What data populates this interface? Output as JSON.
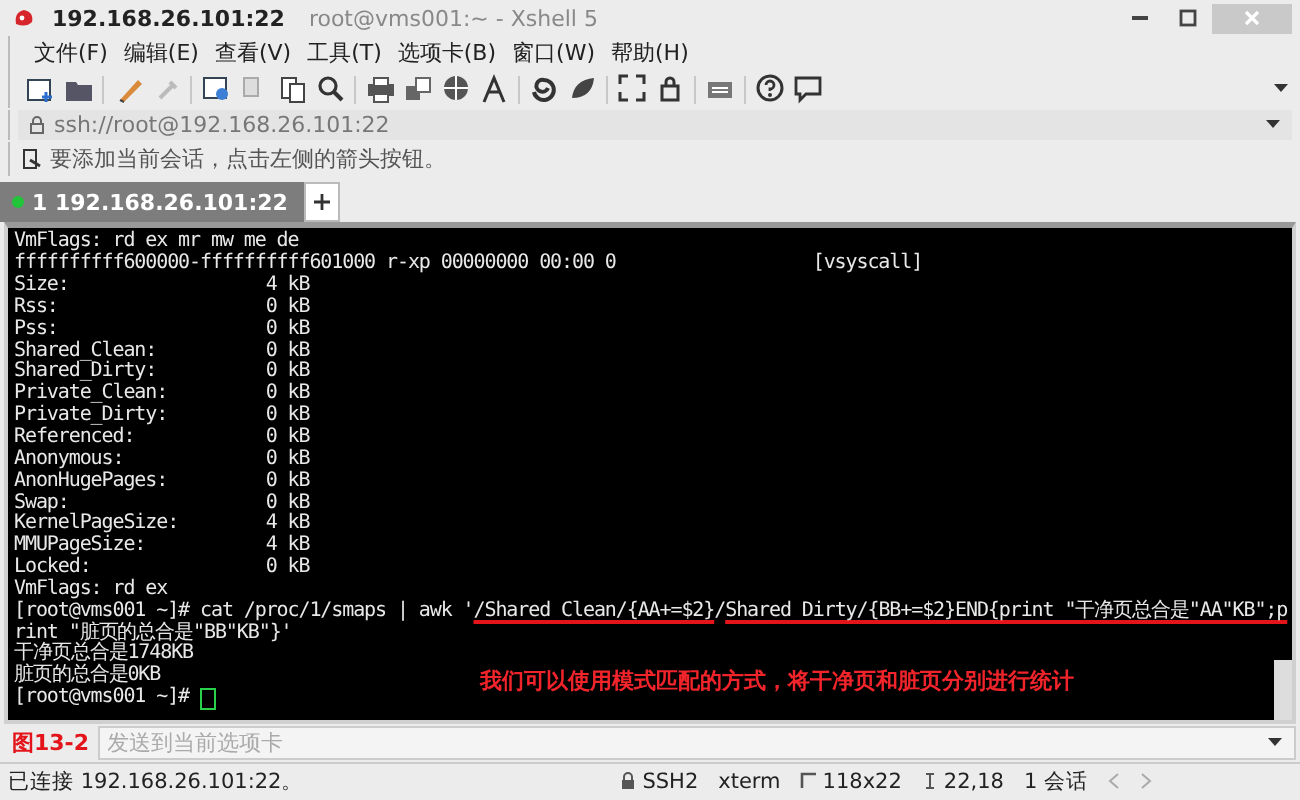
{
  "window": {
    "title": "192.168.26.101:22",
    "subtitle": "root@vms001:~ - Xshell 5"
  },
  "menu": [
    "文件(F)",
    "编辑(E)",
    "查看(V)",
    "工具(T)",
    "选项卡(B)",
    "窗口(W)",
    "帮助(H)"
  ],
  "address": {
    "value": "ssh://root@192.168.26.101:22"
  },
  "hint": "要添加当前会话，点击左侧的箭头按钮。",
  "tabs": [
    {
      "label": "1 192.168.26.101:22",
      "selected": true,
      "connected": true
    }
  ],
  "terminal": {
    "lines": [
      {
        "text": "VmFlags: rd ex mr mw me de"
      },
      {
        "text": "ffffffffff600000-ffffffffff601000 r-xp 00000000 00:00 0                  [vsyscall]"
      },
      {
        "text": "Size:                  4 kB"
      },
      {
        "text": "Rss:                   0 kB"
      },
      {
        "text": "Pss:                   0 kB"
      },
      {
        "text": "Shared_Clean:          0 kB"
      },
      {
        "text": "Shared_Dirty:          0 kB"
      },
      {
        "text": "Private_Clean:         0 kB"
      },
      {
        "text": "Private_Dirty:         0 kB"
      },
      {
        "text": "Referenced:            0 kB"
      },
      {
        "text": "Anonymous:             0 kB"
      },
      {
        "text": "AnonHugePages:         0 kB"
      },
      {
        "text": "Swap:                  0 kB"
      },
      {
        "text": "KernelPageSize:        4 kB"
      },
      {
        "text": "MMUPageSize:           4 kB"
      },
      {
        "text": "Locked:                0 kB"
      },
      {
        "text": "VmFlags: rd ex"
      },
      {
        "segments": [
          {
            "text": "[root@vms001 ~]# cat /proc/1/smaps | awk '",
            "underlined": false
          },
          {
            "text": "/Shared Clean/{AA+=$2}",
            "underlined": true
          },
          {
            "text": "/",
            "underlined": false
          },
          {
            "text": "Shared Dirty/{BB+=$2}",
            "underlined": true
          },
          {
            "text": "END{print \"干净页总合是\"AA\"KB\";p",
            "underlined": true
          }
        ]
      },
      {
        "text": "rint \"脏页的总合是\"BB\"KB\"}'"
      },
      {
        "text": "干净页总合是1748KB"
      },
      {
        "text": "脏页的总合是0KB"
      },
      {
        "text": "[root@vms001 ~]# ",
        "cursor": true
      }
    ]
  },
  "annotation": "我们可以使用模式匹配的方式，将干净页和脏页分别进行统计",
  "figure_label": "图13-2",
  "compose": {
    "placeholder": "发送到当前选项卡"
  },
  "status_bar": {
    "connection": "已连接 192.168.26.101:22。",
    "protocol": "SSH2",
    "terminal": "xterm",
    "size": "118x22",
    "cursor": "22,18",
    "sessions": "1 会话"
  }
}
